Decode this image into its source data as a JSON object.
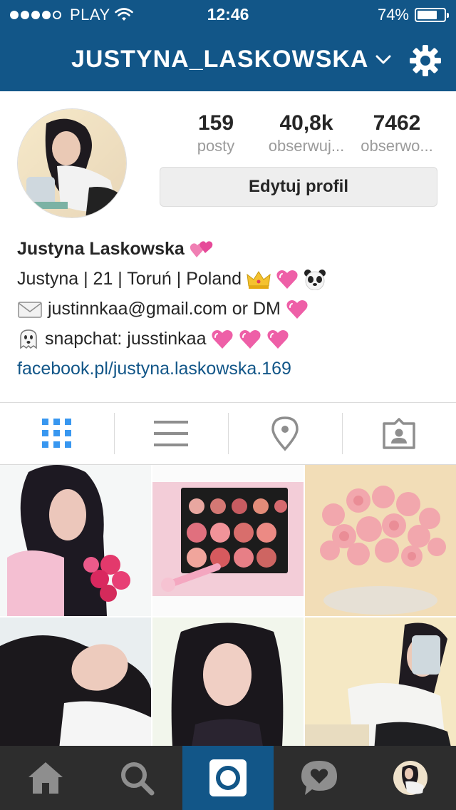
{
  "status_bar": {
    "carrier": "PLAY",
    "time": "12:46",
    "battery": "74%",
    "battery_level": 0.74
  },
  "header": {
    "username": "JUSTYNA_LASKOWSKA"
  },
  "stats": [
    {
      "value": "159",
      "label": "posty"
    },
    {
      "value": "40,8k",
      "label": "obserwuj..."
    },
    {
      "value": "7462",
      "label": "obserwo..."
    }
  ],
  "edit_profile_label": "Edytuj profil",
  "bio": {
    "name": "Justyna Laskowska",
    "line1": "Justyna | 21 | Toruń | Poland",
    "line2": "justinnkaa@gmail.com or DM",
    "line3": "snapchat: jusstinkaa",
    "link": "facebook.pl/justyna.laskowska.169"
  },
  "tabs": [
    "grid-view",
    "list-view",
    "location-view",
    "tagged-view"
  ],
  "colors": {
    "brand": "#125688",
    "tab_active": "#3897f0",
    "icon_gray": "#8e8e8e",
    "bottom_bar": "#2d2d2d"
  }
}
